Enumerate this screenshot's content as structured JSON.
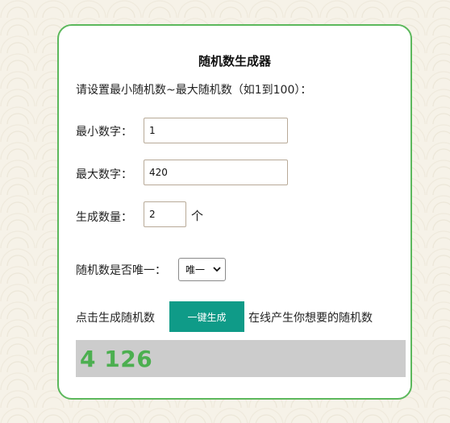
{
  "generator": {
    "title": "随机数生成器",
    "instruction": "请设置最小随机数~最大随机数（如1到100）：",
    "min_label": "最小数字：",
    "min_value": "1",
    "max_label": "最大数字：",
    "max_value": "420",
    "count_label": "生成数量：",
    "count_value": "2",
    "count_unit": "个",
    "unique_label": "随机数是否唯一：",
    "unique_selected": "唯一",
    "click_prefix": "点击生成随机数",
    "generate_button": "一键生成",
    "click_suffix": "在线产生你想要的随机数",
    "result": "4 126"
  },
  "colors": {
    "card_border": "#5cb85c",
    "button_bg": "#0f9b88",
    "result_bg": "#cccccc",
    "result_text": "#4caf50",
    "page_bg": "#f6f2e8"
  }
}
